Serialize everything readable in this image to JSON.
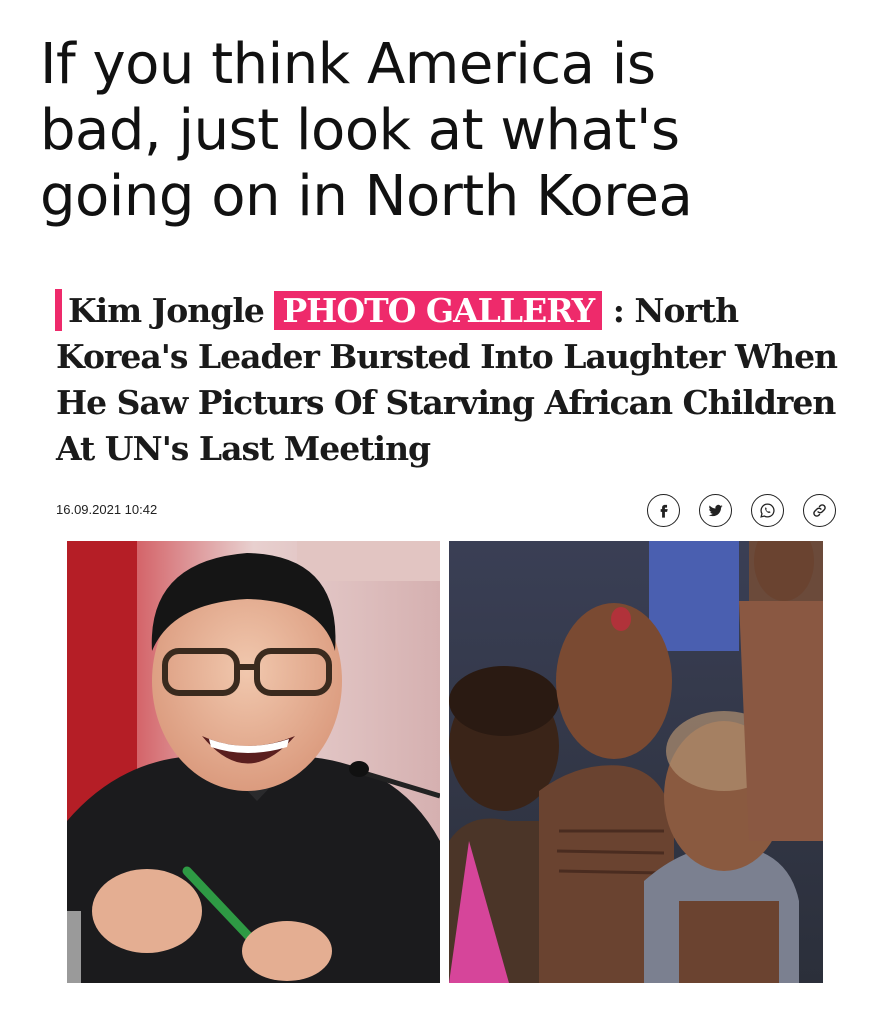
{
  "meme": {
    "caption_lines": [
      "If you think America is",
      "bad, just look at what's",
      "going on in North Korea"
    ]
  },
  "article": {
    "headline_lead": "Kim Jongle",
    "headline_tag": "PHOTO GALLERY",
    "headline_rest": " : North Korea's Leader Bursted Into Laughter When He Saw Picturs Of Starving African Children At UN's Last Meeting",
    "date": "16.09.2021 10:42",
    "share_icons": [
      "facebook-icon",
      "twitter-icon",
      "whatsapp-icon",
      "link-icon"
    ],
    "accent_color": "#ee2a6b",
    "photos": [
      {
        "subject": "kim-jong-un-laughing-photo"
      },
      {
        "subject": "starving-children-photo"
      }
    ]
  }
}
